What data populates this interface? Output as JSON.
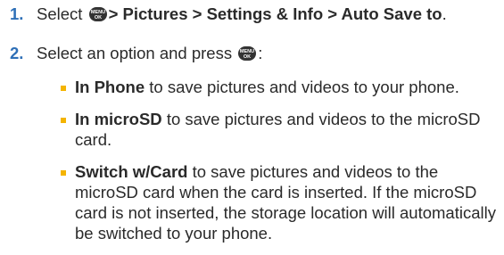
{
  "steps": [
    {
      "number": "1.",
      "prefix": "Select ",
      "key_icon": "menu-ok-key-icon",
      "path": "> Pictures > Settings & Info > Auto Save to",
      "suffix": "."
    },
    {
      "number": "2.",
      "text": "Select an option and press ",
      "key_icon": "menu-ok-key-icon",
      "suffix": ":"
    }
  ],
  "key_labels": {
    "top": "MENU",
    "bottom": "OK"
  },
  "options": [
    {
      "name": "In Phone",
      "description": "to save pictures and videos to your phone."
    },
    {
      "name": "In microSD",
      "description": "to save pictures and videos to the microSD card."
    },
    {
      "name": "Switch w/Card",
      "description": "to save pictures and videos to the microSD card when the card is inserted. If the microSD card is not inserted, the storage location will automatically be switched to your phone."
    }
  ],
  "colors": {
    "step_number": "#2e6fb7",
    "bullet": "#f4b400",
    "text": "#2a2a2a",
    "key_background": "#333333"
  }
}
